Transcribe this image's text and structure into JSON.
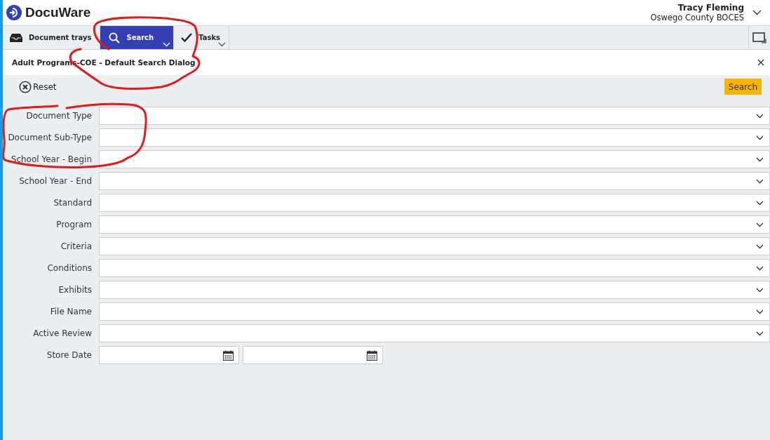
{
  "app": {
    "logo": "DocuWare"
  },
  "user": {
    "name": "Tracy Fleming",
    "organization": "Oswego County BOCES"
  },
  "tabs": [
    {
      "label": "Document trays",
      "selected": false,
      "menu": false
    },
    {
      "label": "Search",
      "selected": true,
      "menu": true
    },
    {
      "label": "Tasks",
      "selected": false,
      "menu": true
    }
  ],
  "dialog": {
    "title": "Adult Programs-COE - Default Search Dialog",
    "reset": "Reset",
    "search": "Search"
  },
  "fields": [
    {
      "label": "Document Type",
      "kind": "dropdown"
    },
    {
      "label": "Document Sub-Type",
      "kind": "dropdown"
    },
    {
      "label": "School Year - Begin",
      "kind": "dropdown"
    },
    {
      "label": "School Year - End",
      "kind": "dropdown"
    },
    {
      "label": "Standard",
      "kind": "dropdown"
    },
    {
      "label": "Program",
      "kind": "dropdown"
    },
    {
      "label": "Criteria",
      "kind": "dropdown"
    },
    {
      "label": "Conditions",
      "kind": "dropdown"
    },
    {
      "label": "Exhibits",
      "kind": "dropdown"
    },
    {
      "label": "File Name",
      "kind": "dropdown"
    },
    {
      "label": "Active Review",
      "kind": "dropdown"
    },
    {
      "label": "Store Date",
      "kind": "daterange"
    }
  ]
}
